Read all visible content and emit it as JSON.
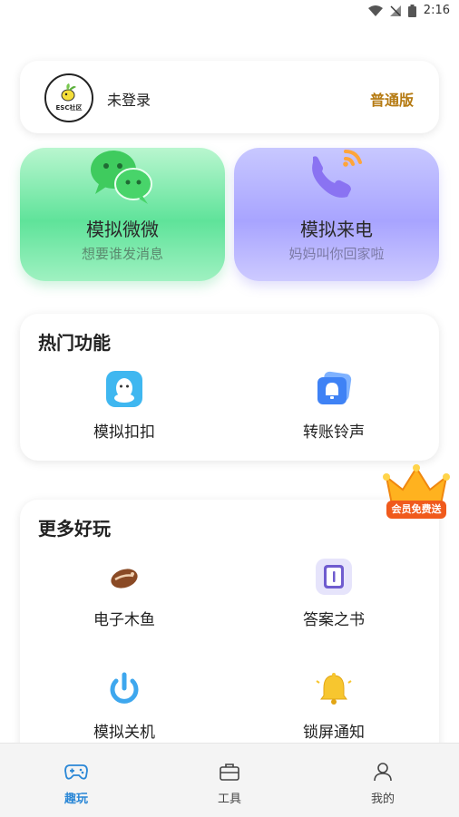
{
  "status_bar": {
    "time": "2:16"
  },
  "user_card": {
    "name": "未登录",
    "level": "普通版",
    "avatar_text": "ESC社区"
  },
  "feature_cards": [
    {
      "title": "模拟微微",
      "subtitle": "想要谁发消息"
    },
    {
      "title": "模拟来电",
      "subtitle": "妈妈叫你回家啦"
    }
  ],
  "hot_section": {
    "title": "热门功能",
    "items": [
      {
        "label": "模拟扣扣"
      },
      {
        "label": "转账铃声"
      }
    ]
  },
  "more_section": {
    "title": "更多好玩",
    "items": [
      {
        "label": "电子木鱼"
      },
      {
        "label": "答案之书"
      },
      {
        "label": "模拟关机"
      },
      {
        "label": "锁屏通知"
      }
    ]
  },
  "vip_badge": {
    "label": "会员免费送"
  },
  "tab_bar": {
    "tabs": [
      {
        "label": "趣玩",
        "active": true
      },
      {
        "label": "工具",
        "active": false
      },
      {
        "label": "我的",
        "active": false
      }
    ]
  },
  "colors": {
    "accent": "#2a87d6",
    "level": "#b57a12",
    "wechat_green": "#4fd38c",
    "call_purple": "#a6a2ff",
    "vip_orange": "#f05a1c"
  }
}
